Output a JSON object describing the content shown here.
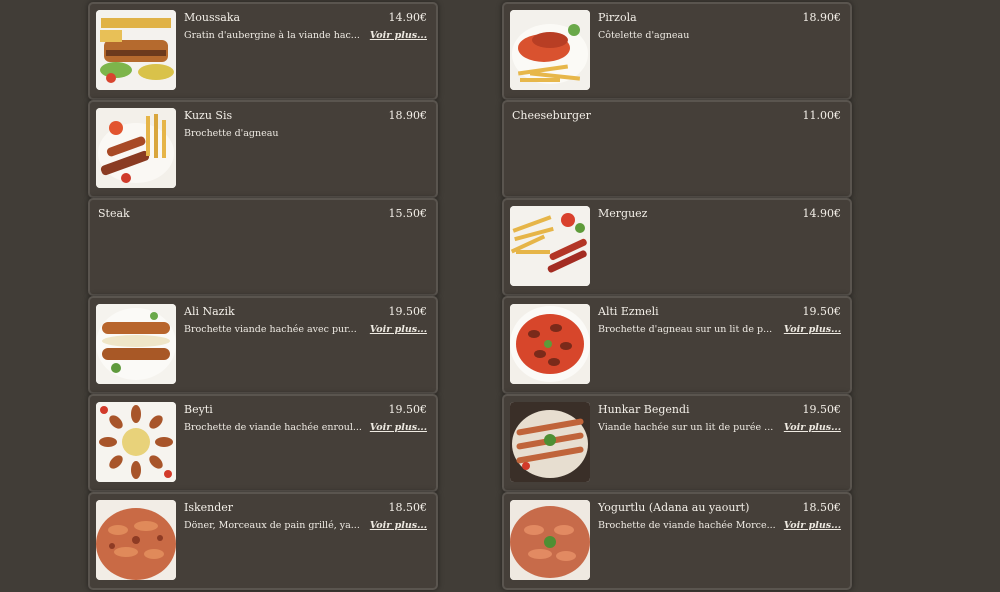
{
  "menu": {
    "more_label": "Voir plus...",
    "left": [
      {
        "name": "Moussaka",
        "price": "14.90€",
        "desc": "Gratin d'aubergine à la viande hac...",
        "img": "moussaka-photo"
      },
      {
        "name": "Kuzu Sis",
        "price": "18.90€",
        "desc": "Brochette d'agneau",
        "img": "kuzu-sis-photo"
      },
      {
        "name": "Steak",
        "price": "15.50€",
        "desc": "",
        "img": ""
      },
      {
        "name": "Ali Nazik",
        "price": "19.50€",
        "desc": "Brochette viande hachée avec pur...",
        "img": "ali-nazik-photo"
      },
      {
        "name": "Beyti",
        "price": "19.50€",
        "desc": "Brochette de viande hachée enroul...",
        "img": "beyti-photo"
      },
      {
        "name": "Iskender",
        "price": "18.50€",
        "desc": "Döner, Morceaux de pain grillé, ya...",
        "img": "iskender-photo"
      }
    ],
    "right": [
      {
        "name": "Pirzola",
        "price": "18.90€",
        "desc": "Côtelette d'agneau",
        "img": "pirzola-photo"
      },
      {
        "name": "Cheeseburger",
        "price": "11.00€",
        "desc": "",
        "img": ""
      },
      {
        "name": "Merguez",
        "price": "14.90€",
        "desc": "",
        "img": "merguez-photo"
      },
      {
        "name": "Alti Ezmeli",
        "price": "19.50€",
        "desc": "Brochette d'agneau sur un lit de p...",
        "img": "alti-ezmeli-photo"
      },
      {
        "name": "Hunkar Begendi",
        "price": "19.50€",
        "desc": "Viande hachée sur un lit de purée ...",
        "img": "hunkar-begendi-photo"
      },
      {
        "name": "Yogurtlu (Adana au yaourt)",
        "price": "18.50€",
        "desc": "Brochette de viande hachée Morce...",
        "img": "yogurtlu-photo"
      }
    ]
  }
}
